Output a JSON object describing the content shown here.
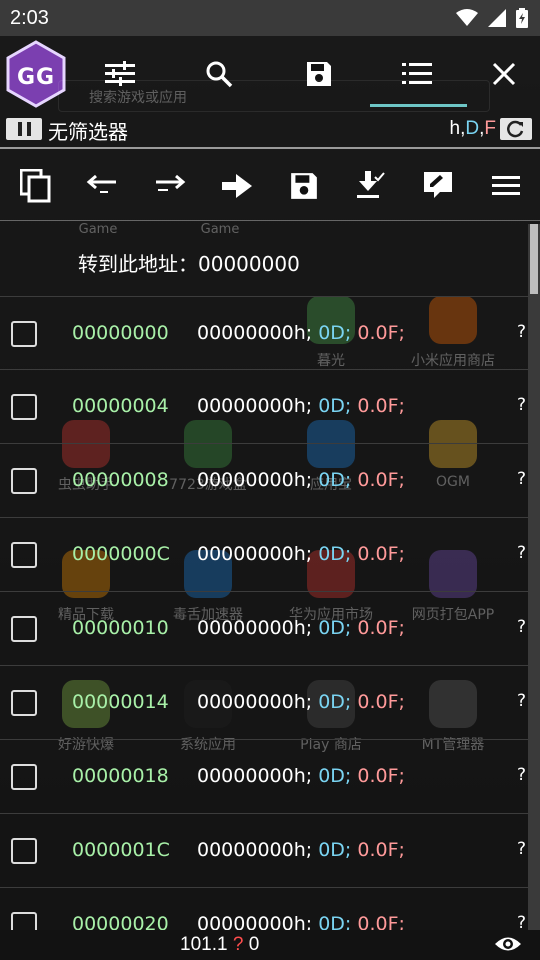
{
  "status_bar": {
    "time": "2:03"
  },
  "toolbar": {
    "tab_active_index": 3,
    "search_placeholder": "搜索游戏或应用"
  },
  "filter_row": {
    "label": "无筛选器",
    "format_h": "h,",
    "format_d": "D",
    "format_sep": ",",
    "format_f": "F"
  },
  "background_apps": [
    {
      "label": "Game",
      "color": "#e53935"
    },
    {
      "label": "Game",
      "color": "#e53935"
    },
    {
      "label": "暮光",
      "color": "#4caf50"
    },
    {
      "label": "小米应用商店",
      "color": "#ff6d00"
    },
    {
      "label": "虫虫助手",
      "color": "#e53935"
    },
    {
      "label": "7723游戏盒",
      "color": "#43a047"
    },
    {
      "label": "应用宝",
      "color": "#1e88e5"
    },
    {
      "label": "OGM",
      "color": "#fbc02d"
    },
    {
      "label": "精品下载",
      "color": "#ff9800"
    },
    {
      "label": "毒舌加速器",
      "color": "#1e88e5"
    },
    {
      "label": "华为应用市场",
      "color": "#e53935"
    },
    {
      "label": "网页打包APP",
      "color": "#7e57c2"
    },
    {
      "label": "好游快爆",
      "color": "#8bc34a"
    },
    {
      "label": "系统应用",
      "color": "#222222"
    },
    {
      "label": "Play 商店",
      "color": "#555555"
    },
    {
      "label": "MT管理器",
      "color": "#666666"
    }
  ],
  "goto": {
    "label": "转到此地址：",
    "address": "00000000"
  },
  "rows": [
    {
      "addr": "00000000",
      "hex": "00000000h;",
      "dec": "0D;",
      "flt": "0.0F;",
      "q": "?"
    },
    {
      "addr": "00000004",
      "hex": "00000000h;",
      "dec": "0D;",
      "flt": "0.0F;",
      "q": "?"
    },
    {
      "addr": "00000008",
      "hex": "00000000h;",
      "dec": "0D;",
      "flt": "0.0F;",
      "q": "?"
    },
    {
      "addr": "0000000C",
      "hex": "00000000h;",
      "dec": "0D;",
      "flt": "0.0F;",
      "q": "?"
    },
    {
      "addr": "00000010",
      "hex": "00000000h;",
      "dec": "0D;",
      "flt": "0.0F;",
      "q": "?"
    },
    {
      "addr": "00000014",
      "hex": "00000000h;",
      "dec": "0D;",
      "flt": "0.0F;",
      "q": "?"
    },
    {
      "addr": "00000018",
      "hex": "00000000h;",
      "dec": "0D;",
      "flt": "0.0F;",
      "q": "?"
    },
    {
      "addr": "0000001C",
      "hex": "00000000h;",
      "dec": "0D;",
      "flt": "0.0F;",
      "q": "?"
    },
    {
      "addr": "00000020",
      "hex": "00000000h;",
      "dec": "0D;",
      "flt": "0.0F;",
      "q": "?"
    }
  ],
  "bottom": {
    "version": "101.1",
    "qmark": "?",
    "count": "0"
  },
  "colors": {
    "address": "#a8f0a8",
    "dec": "#7ad4f2",
    "float": "#ff9a9a",
    "tab_underline": "#6ec6c6"
  }
}
